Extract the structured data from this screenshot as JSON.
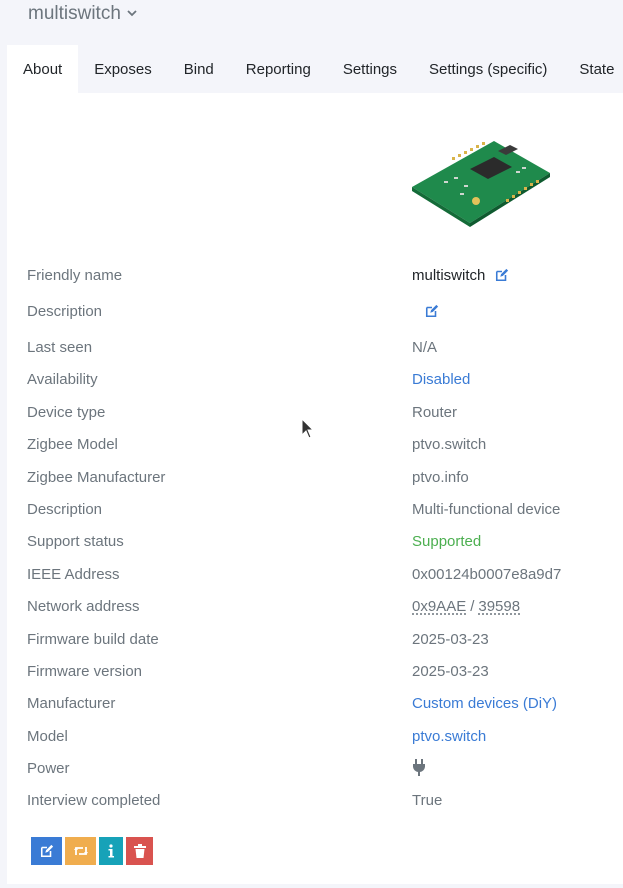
{
  "header": {
    "device_name": "multiswitch"
  },
  "tabs": [
    {
      "label": "About",
      "active": true
    },
    {
      "label": "Exposes"
    },
    {
      "label": "Bind"
    },
    {
      "label": "Reporting"
    },
    {
      "label": "Settings"
    },
    {
      "label": "Settings (specific)"
    },
    {
      "label": "State"
    }
  ],
  "about": {
    "friendly_name": {
      "label": "Friendly name",
      "value": "multiswitch"
    },
    "description_edit": {
      "label": "Description"
    },
    "last_seen": {
      "label": "Last seen",
      "value": "N/A"
    },
    "availability": {
      "label": "Availability",
      "value": "Disabled"
    },
    "device_type": {
      "label": "Device type",
      "value": "Router"
    },
    "zigbee_model": {
      "label": "Zigbee Model",
      "value": "ptvo.switch"
    },
    "zigbee_manufacturer": {
      "label": "Zigbee Manufacturer",
      "value": "ptvo.info"
    },
    "description": {
      "label": "Description",
      "value": "Multi-functional device"
    },
    "support_status": {
      "label": "Support status",
      "value": "Supported"
    },
    "ieee_address": {
      "label": "IEEE Address",
      "value": "0x00124b0007e8a9d7"
    },
    "network_address": {
      "label": "Network address",
      "hex": "0x9AAE",
      "separator": "/",
      "dec": "39598"
    },
    "firmware_build_date": {
      "label": "Firmware build date",
      "value": "2025-03-23"
    },
    "firmware_version": {
      "label": "Firmware version",
      "value": "2025-03-23"
    },
    "manufacturer": {
      "label": "Manufacturer",
      "value": "Custom devices (DiY)"
    },
    "model": {
      "label": "Model",
      "value": "ptvo.switch"
    },
    "power": {
      "label": "Power",
      "icon": "plug-icon"
    },
    "interview_completed": {
      "label": "Interview completed",
      "value": "True"
    }
  },
  "actions": {
    "rename_icon": "edit-icon",
    "reconfigure_icon": "retweet-icon",
    "interview_icon": "info-icon",
    "remove_icon": "trash-icon"
  },
  "colors": {
    "link": "#3a7bd5",
    "supported": "#4caf50",
    "button_blue": "#3a7bd5",
    "button_orange": "#f0ad4e",
    "button_info": "#17a2b8",
    "button_red": "#d9534f"
  }
}
